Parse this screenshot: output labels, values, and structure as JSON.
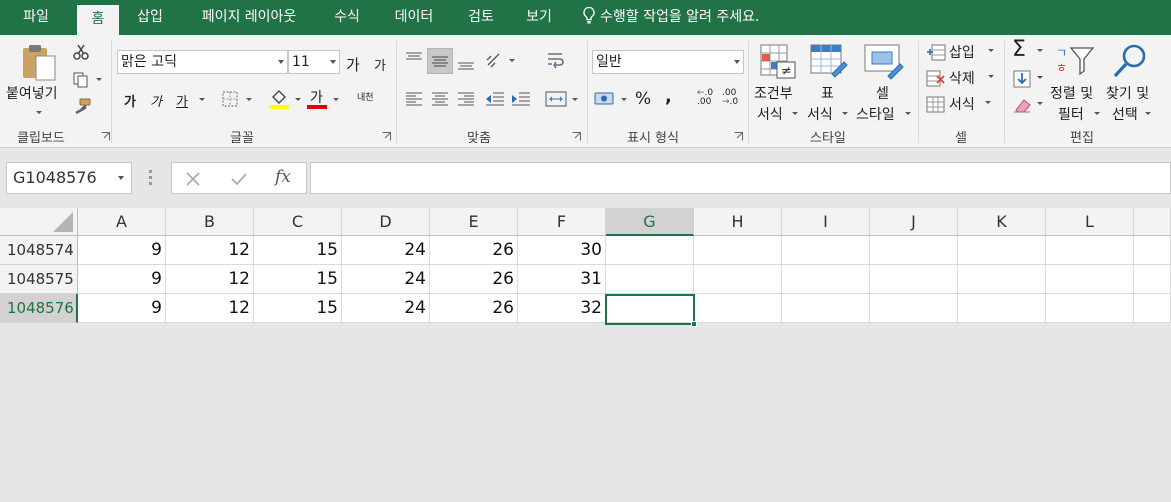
{
  "tabs": [
    {
      "label": "파일"
    },
    {
      "label": "홈"
    },
    {
      "label": "삽입"
    },
    {
      "label": "페이지 레이아웃"
    },
    {
      "label": "수식"
    },
    {
      "label": "데이터"
    },
    {
      "label": "검토"
    },
    {
      "label": "보기"
    }
  ],
  "tell_me": "수행할 작업을 알려 주세요.",
  "ribbon": {
    "clipboard": {
      "paste_label": "붙여넣기",
      "group_label": "클립보드"
    },
    "font": {
      "font_name": "맑은 고딕",
      "font_size": "11",
      "grow_label": "가",
      "shrink_label": "가",
      "bold_label": "가",
      "italic_label": "가",
      "underline_label": "가",
      "font_color_label": "가",
      "phonetic_label": "내천",
      "group_label": "글꼴"
    },
    "alignment": {
      "group_label": "맞춤"
    },
    "number": {
      "format": "일반",
      "percent": "%",
      "comma": ",",
      "inc_decimal": ".00",
      "dec_decimal": ".0",
      "group_label": "표시 형식"
    },
    "styles": {
      "conditional_line1": "조건부",
      "conditional_line2": "서식",
      "table_line1": "표",
      "table_line2": "서식",
      "cell_line1": "셀",
      "cell_line2": "스타일",
      "group_label": "스타일"
    },
    "cells": {
      "insert": "삽입",
      "delete": "삭제",
      "format": "서식",
      "group_label": "셀"
    },
    "editing": {
      "sort_line1": "정렬 및",
      "sort_line2": "필터",
      "find_line1": "찾기 및",
      "find_line2": "선택",
      "group_label": "편집"
    }
  },
  "formula_bar": {
    "name_box": "G1048576",
    "formula": "",
    "fx": "fx"
  },
  "columns": [
    "A",
    "B",
    "C",
    "D",
    "E",
    "F",
    "G",
    "H",
    "I",
    "J",
    "K",
    "L"
  ],
  "selected_column": "G",
  "rows": [
    {
      "number": "1048574",
      "cells": [
        "9",
        "12",
        "15",
        "24",
        "26",
        "30",
        "",
        "",
        "",
        "",
        "",
        ""
      ]
    },
    {
      "number": "1048575",
      "cells": [
        "9",
        "12",
        "15",
        "24",
        "26",
        "31",
        "",
        "",
        "",
        "",
        "",
        ""
      ]
    },
    {
      "number": "1048576",
      "cells": [
        "9",
        "12",
        "15",
        "24",
        "26",
        "32",
        "",
        "",
        "",
        "",
        "",
        ""
      ]
    }
  ],
  "selected_row": "1048576",
  "colors": {
    "accent": "#217346",
    "ribbon_bg": "#f3f3f3",
    "app_bg": "#e6e6e6"
  }
}
